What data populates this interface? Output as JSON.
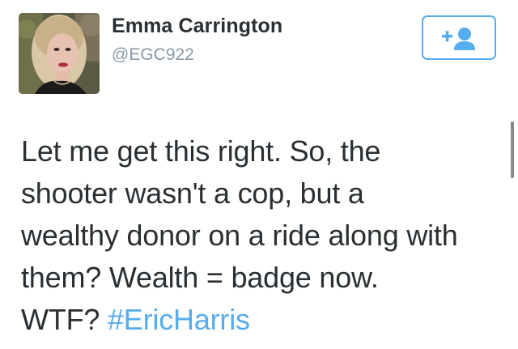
{
  "user": {
    "display_name": "Emma Carrington",
    "handle": "@EGC922",
    "avatar_icon": "profile-photo"
  },
  "follow_button": {
    "icon": "add-user-icon",
    "accent_color": "#55acee"
  },
  "tweet": {
    "line1": "Let me get this right. So, the",
    "line2": "shooter wasn't a cop, but a",
    "line3": "wealthy donor on a ride along with",
    "line4": "them? Wealth = badge now.",
    "line5_prefix": "WTF? ",
    "hashtag": "#EricHarris"
  },
  "colors": {
    "text": "#292f33",
    "secondary": "#8899a6",
    "link": "#55acee"
  }
}
